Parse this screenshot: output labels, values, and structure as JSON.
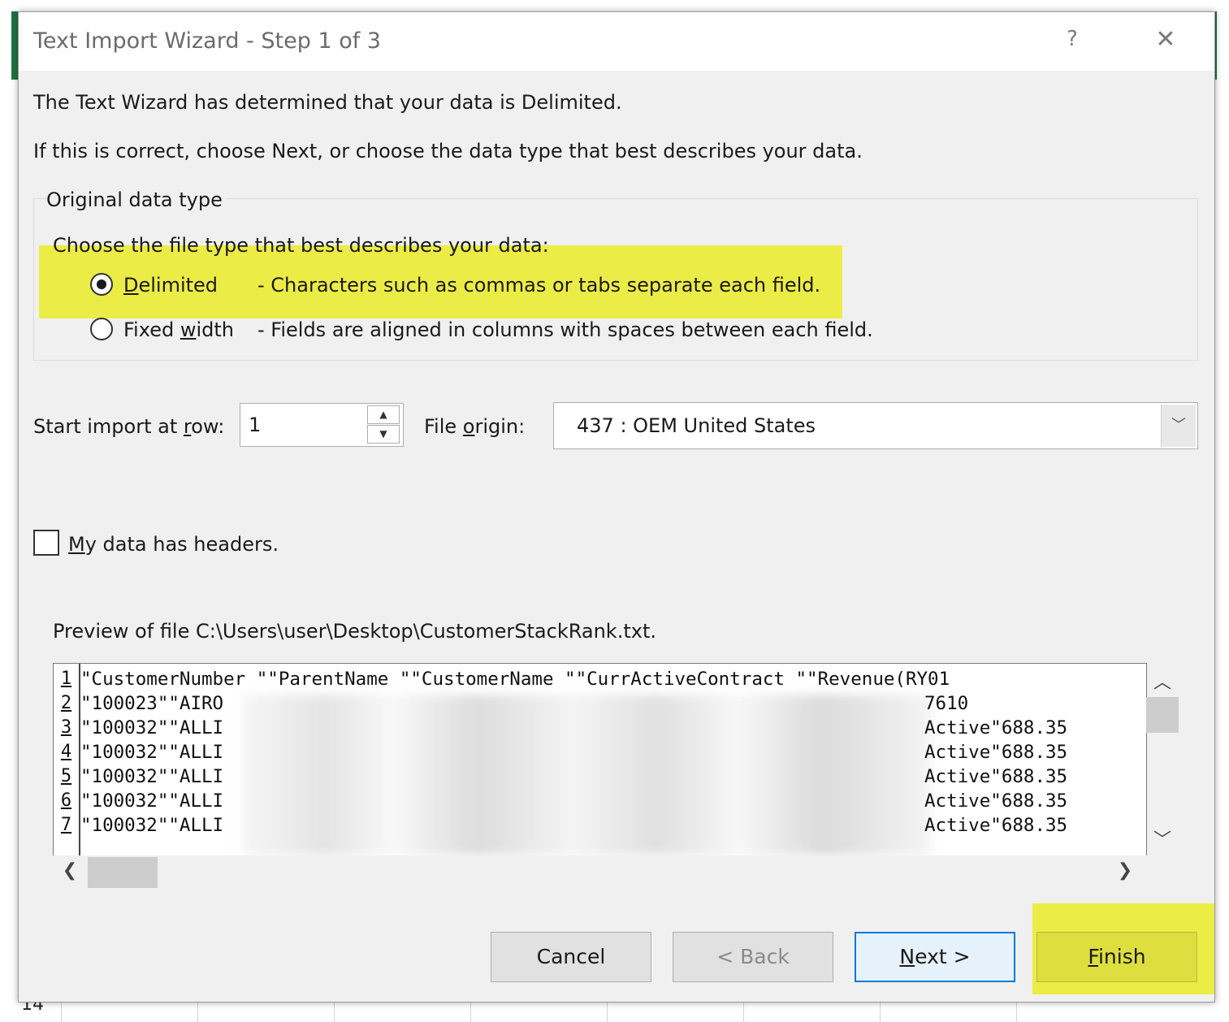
{
  "dialog": {
    "title": "Text Import Wizard - Step 1 of 3",
    "help_label": "?",
    "close_label": "✕"
  },
  "intro": {
    "line1": "The Text Wizard has determined that your data is Delimited.",
    "line2": "If this is correct, choose Next, or choose the data type that best describes your data."
  },
  "data_type": {
    "group_title": "Original data type",
    "prompt": "Choose the file type that best describes your data:",
    "options": [
      {
        "label_pre": "",
        "label_u": "D",
        "label_post": "elimited",
        "description": "- Characters such as commas or tabs separate each field.",
        "selected": true
      },
      {
        "label_pre": "Fixed ",
        "label_u": "w",
        "label_post": "idth",
        "description": "- Fields are aligned in columns with spaces between each field.",
        "selected": false
      }
    ]
  },
  "start_row": {
    "label_pre": "Start import at ",
    "label_u": "r",
    "label_post": "ow:",
    "value": "1",
    "up_icon": "▲",
    "down_icon": "▼"
  },
  "file_origin": {
    "label_pre": "File ",
    "label_u": "o",
    "label_post": "rigin:",
    "value": "437 : OEM United States",
    "arrow": "﹀"
  },
  "headers": {
    "label_u": "M",
    "label_post": "y data has headers."
  },
  "preview": {
    "title": "Preview of file C:\\Users\\user\\Desktop\\CustomerStackRank.txt.",
    "rows": [
      {
        "num": "1",
        "left": "\"CustomerNumber \"\"ParentName \"\"CustomerName \"\"CurrActiveContract \"\"Revenue(RY01",
        "right": ""
      },
      {
        "num": "2",
        "left": "\"100023\"\"AIRO",
        "right": "7610"
      },
      {
        "num": "3",
        "left": "\"100032\"\"ALLI",
        "right": "Active\"688.35"
      },
      {
        "num": "4",
        "left": "\"100032\"\"ALLI",
        "right": "Active\"688.35"
      },
      {
        "num": "5",
        "left": "\"100032\"\"ALLI",
        "right": "Active\"688.35"
      },
      {
        "num": "6",
        "left": "\"100032\"\"ALLI",
        "right": "Active\"688.35"
      },
      {
        "num": "7",
        "left": "\"100032\"\"ALLI",
        "right": "Active\"688.35"
      }
    ],
    "scroll_up": "︿",
    "scroll_down": "﹀",
    "scroll_left": "❮",
    "scroll_right": "❯"
  },
  "buttons": {
    "cancel": "Cancel",
    "back": "< Back",
    "next_u": "N",
    "next_post": "ext >",
    "finish_u": "F",
    "finish_post": "inish"
  },
  "background": {
    "row_label": "14"
  },
  "colors": {
    "highlight": "#ecec46",
    "excel_green": "#217346",
    "primary_border": "#0078d7"
  }
}
